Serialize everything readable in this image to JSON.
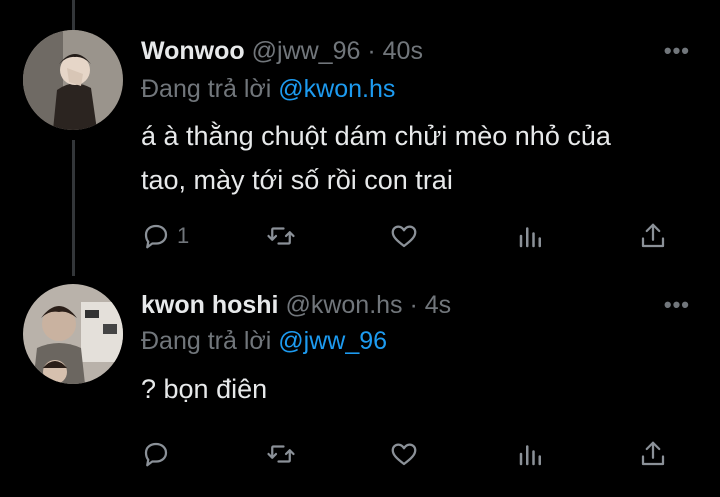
{
  "tweets": [
    {
      "name": "Wonwoo",
      "handle": "@jww_96",
      "time": "· 40s",
      "reply_label": "Đang trả lời",
      "reply_handle": "@kwon.hs",
      "text_line1": "á à thằng chuột dám chửi mèo nhỏ của",
      "text_line2": "tao, mày tới số rồi con trai",
      "reply_count": "1",
      "more": "•••"
    },
    {
      "name": "kwon hoshi",
      "handle": "@kwon.hs",
      "time": "· 4s",
      "reply_label": "Đang trả lời",
      "reply_handle": "@jww_96",
      "text_line1": "? bọn điên",
      "reply_count": "",
      "more": "•••"
    }
  ],
  "icons": [
    "reply-icon",
    "retweet-icon",
    "like-icon",
    "views-icon",
    "share-icon",
    "more-icon"
  ],
  "colors": {
    "background": "#000000",
    "text": "#e7e9ea",
    "muted": "#71767b",
    "link": "#1d9bf0"
  }
}
